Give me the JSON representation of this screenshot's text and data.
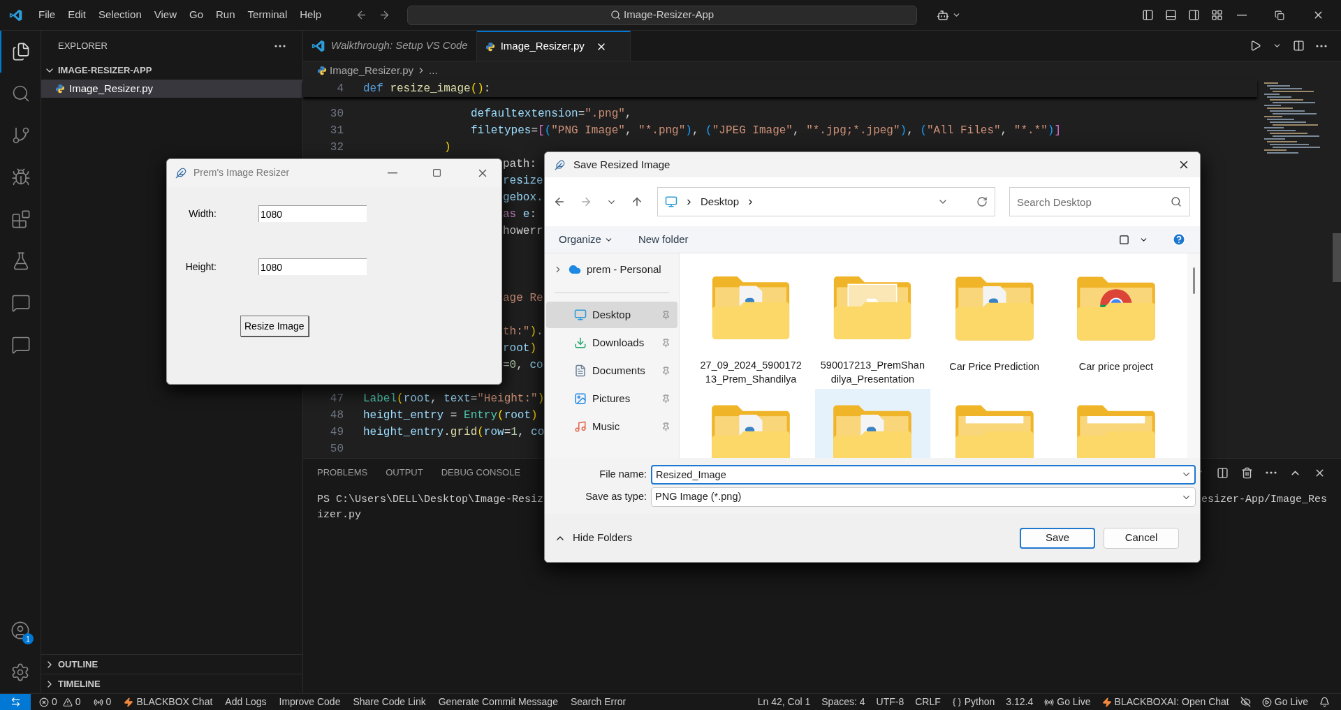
{
  "title_bar": {
    "menu": [
      "File",
      "Edit",
      "Selection",
      "View",
      "Go",
      "Run",
      "Terminal",
      "Help"
    ],
    "search": "Image-Resizer-App"
  },
  "activity_bar": [
    {
      "kind": "explorer",
      "selected": true
    },
    {
      "kind": "search",
      "selected": false
    },
    {
      "kind": "source-control",
      "selected": false
    },
    {
      "kind": "run-debug",
      "selected": false
    },
    {
      "kind": "extensions",
      "selected": false
    },
    {
      "kind": "testing",
      "selected": false
    },
    {
      "kind": "chat",
      "selected": false
    },
    {
      "kind": "chat",
      "selected": false
    }
  ],
  "account_badge": "1",
  "sidebar": {
    "title": "EXPLORER",
    "folder": {
      "label": "IMAGE-RESIZER-APP",
      "expanded": true,
      "files": [
        {
          "label": "Image_Resizer.py",
          "selected": true
        }
      ]
    },
    "sections": [
      {
        "label": "OUTLINE",
        "expanded": false
      },
      {
        "label": "TIMELINE",
        "expanded": false
      }
    ]
  },
  "tabs": [
    {
      "label": "Walkthrough: Setup VS Code",
      "kind": "welcome",
      "selected": false
    },
    {
      "label": "Image_Resizer.py",
      "kind": "python",
      "selected": true
    }
  ],
  "breadcrumb": [
    "Image_Resizer.py",
    "..."
  ],
  "sticky_line": {
    "number": "4",
    "tokens": [
      {
        "kind": "kw",
        "text": "def "
      },
      {
        "kind": "fn",
        "text": "resize_image"
      },
      {
        "kind": "b1",
        "text": "()"
      },
      {
        "kind": "p",
        "text": ":"
      }
    ]
  },
  "code_lines": [
    {
      "kind": "deep",
      "number": "30",
      "tokens": [
        {
          "kind": "var",
          "text": "defaultextension"
        },
        {
          "kind": "p",
          "text": "="
        },
        {
          "kind": "str",
          "text": "\".png\""
        },
        {
          "kind": "p",
          "text": ","
        }
      ]
    },
    {
      "kind": "deep",
      "number": "31",
      "tokens": [
        {
          "kind": "var",
          "text": "filetypes"
        },
        {
          "kind": "p",
          "text": "="
        },
        {
          "kind": "b2",
          "text": "["
        },
        {
          "kind": "b3",
          "text": "("
        },
        {
          "kind": "str",
          "text": "\"PNG Image\""
        },
        {
          "kind": "p",
          "text": ", "
        },
        {
          "kind": "str",
          "text": "\"*.png\""
        },
        {
          "kind": "b3",
          "text": ")"
        },
        {
          "kind": "p",
          "text": ", "
        },
        {
          "kind": "b3",
          "text": "("
        },
        {
          "kind": "str",
          "text": "\"JPEG Image\""
        },
        {
          "kind": "p",
          "text": ", "
        },
        {
          "kind": "str",
          "text": "\"*.jpg;*.jpeg\""
        },
        {
          "kind": "b3",
          "text": ")"
        },
        {
          "kind": "p",
          "text": ", "
        },
        {
          "kind": "b3",
          "text": "("
        },
        {
          "kind": "str",
          "text": "\"All Files\""
        },
        {
          "kind": "p",
          "text": ", "
        },
        {
          "kind": "str",
          "text": "\"*.*\""
        },
        {
          "kind": "b3",
          "text": ")"
        },
        {
          "kind": "b2",
          "text": "]"
        }
      ]
    },
    {
      "kind": "mid",
      "number": "32",
      "tokens": [
        {
          "kind": "b1",
          "text": ")"
        }
      ]
    },
    {
      "kind": "clipped",
      "tokens": [
        {
          "kind": "p",
          "text": "path:"
        }
      ]
    },
    {
      "kind": "clipped",
      "tokens": [
        {
          "kind": "var",
          "text": "resize"
        }
      ]
    },
    {
      "kind": "clipped",
      "tokens": [
        {
          "kind": "var",
          "text": "gebox."
        }
      ]
    },
    {
      "kind": "clipped",
      "tokens": [
        {
          "kind": "ctrl",
          "text": "as"
        },
        {
          "kind": "var",
          "text": " e"
        },
        {
          "kind": "p",
          "text": ":"
        }
      ]
    },
    {
      "kind": "clipped",
      "tokens": [
        {
          "kind": "p",
          "text": "howerr"
        }
      ]
    },
    {
      "kind": "blank"
    },
    {
      "kind": "blank"
    },
    {
      "kind": "blank"
    },
    {
      "kind": "clipped",
      "tokens": [
        {
          "kind": "str",
          "text": "age Re"
        }
      ]
    },
    {
      "kind": "blank"
    },
    {
      "kind": "clipped",
      "tokens": [
        {
          "kind": "str",
          "text": "th:\""
        },
        {
          "kind": "b1",
          "text": ")"
        },
        {
          "kind": "p",
          "text": "."
        }
      ]
    },
    {
      "kind": "clipped",
      "tokens": [
        {
          "kind": "var",
          "text": "root"
        },
        {
          "kind": "b1",
          "text": ")"
        }
      ]
    },
    {
      "kind": "clipped",
      "tokens": [
        {
          "kind": "p",
          "text": "="
        },
        {
          "kind": "num",
          "text": "0"
        },
        {
          "kind": "p",
          "text": ", "
        },
        {
          "kind": "var",
          "text": "co"
        }
      ]
    },
    {
      "kind": "blank"
    },
    {
      "kind": "flush",
      "number": "47",
      "tokens": [
        {
          "kind": "cls",
          "text": "Label"
        },
        {
          "kind": "b1",
          "text": "("
        },
        {
          "kind": "var",
          "text": "root"
        },
        {
          "kind": "p",
          "text": ", "
        },
        {
          "kind": "var",
          "text": "text"
        },
        {
          "kind": "p",
          "text": "="
        },
        {
          "kind": "str",
          "text": "\"Height:\""
        },
        {
          "kind": "b1",
          "text": ")"
        }
      ]
    },
    {
      "kind": "flush",
      "number": "48",
      "tokens": [
        {
          "kind": "var",
          "text": "height_entry"
        },
        {
          "kind": "p",
          "text": " = "
        },
        {
          "kind": "cls",
          "text": "Entry"
        },
        {
          "kind": "b1",
          "text": "("
        },
        {
          "kind": "var",
          "text": "root"
        },
        {
          "kind": "b1",
          "text": ")"
        }
      ]
    },
    {
      "kind": "flush",
      "number": "49",
      "tokens": [
        {
          "kind": "var",
          "text": "height_entry"
        },
        {
          "kind": "p",
          "text": "."
        },
        {
          "kind": "fn",
          "text": "grid"
        },
        {
          "kind": "b1",
          "text": "("
        },
        {
          "kind": "var",
          "text": "row"
        },
        {
          "kind": "p",
          "text": "="
        },
        {
          "kind": "num",
          "text": "1"
        },
        {
          "kind": "p",
          "text": ", "
        },
        {
          "kind": "var",
          "text": "co"
        }
      ]
    },
    {
      "kind": "flush",
      "number": "50"
    }
  ],
  "panel": {
    "tabs": [
      {
        "label": "PROBLEMS",
        "selected": false
      },
      {
        "label": "OUTPUT",
        "selected": false
      },
      {
        "label": "DEBUG CONSOLE",
        "selected": false
      }
    ],
    "terminal_lines": [
      {
        "left": "PS C:\\Users\\DELL\\Desktop\\Image-Resiz",
        "right": "esizer-App/Image_Res"
      },
      {
        "left": "izer.py"
      }
    ]
  },
  "status_bar": {
    "left": [
      {
        "kind": "remote"
      },
      {
        "kind": "problems",
        "errors": "0",
        "warnings": "0"
      },
      {
        "kind": "ports",
        "text": "0"
      },
      {
        "kind": "flash",
        "text": "BLACKBOX Chat"
      },
      {
        "kind": "plain",
        "text": "Add Logs"
      },
      {
        "kind": "plain",
        "text": "Improve Code"
      },
      {
        "kind": "plain",
        "text": "Share Code Link"
      },
      {
        "kind": "plain",
        "text": "Generate Commit Message"
      },
      {
        "kind": "plain",
        "text": "Search Error"
      }
    ],
    "right": [
      {
        "kind": "plain",
        "text": "Ln 42, Col 1"
      },
      {
        "kind": "plain",
        "text": "Spaces: 4"
      },
      {
        "kind": "plain",
        "text": "UTF-8"
      },
      {
        "kind": "plain",
        "text": "CRLF"
      },
      {
        "kind": "braces",
        "text": "Python"
      },
      {
        "kind": "plain",
        "text": "3.12.4"
      },
      {
        "kind": "broadcast",
        "text": "Go Live"
      },
      {
        "kind": "flash",
        "text": "BLACKBOXAI: Open Chat"
      },
      {
        "kind": "hidden-eye"
      },
      {
        "kind": "play-circle",
        "text": "Go Live"
      },
      {
        "kind": "bell"
      }
    ]
  },
  "tk_window": {
    "title": "Prem's Image Resizer",
    "fields": [
      {
        "label": "Width:",
        "value": "1080"
      },
      {
        "label": "Height:",
        "value": "1080"
      }
    ],
    "button": "Resize Image"
  },
  "save_dialog": {
    "title": "Save Resized Image",
    "path": [
      "Desktop"
    ],
    "search_placeholder": "Search Desktop",
    "organize": "Organize",
    "new_folder": "New folder",
    "nav": [
      {
        "label": "prem - Personal",
        "kind": "cloud",
        "selected": false,
        "pinned": false
      },
      {
        "label": "Desktop",
        "kind": "desktop",
        "selected": true,
        "pinned": true
      },
      {
        "label": "Downloads",
        "kind": "downloads",
        "selected": false,
        "pinned": true
      },
      {
        "label": "Documents",
        "kind": "documents",
        "selected": false,
        "pinned": true
      },
      {
        "label": "Pictures",
        "kind": "pictures",
        "selected": false,
        "pinned": true
      },
      {
        "label": "Music",
        "kind": "music",
        "selected": false,
        "pinned": true
      }
    ],
    "items": [
      {
        "label": "27_09_2024_590017213_Prem_Shandilya",
        "kind": "python",
        "selected": false
      },
      {
        "label": "590017213_PremShandilya_Presentation",
        "kind": "document",
        "selected": false
      },
      {
        "label": "Car Price Prediction",
        "kind": "python",
        "selected": false
      },
      {
        "label": "Car price project",
        "kind": "ring",
        "selected": false
      },
      {
        "kind": "python",
        "selected": false
      },
      {
        "kind": "python",
        "selected": true
      },
      {
        "kind": "plain",
        "selected": false
      },
      {
        "kind": "plain",
        "selected": false
      }
    ],
    "file_name_label": "File name:",
    "file_name": "Resized_Image",
    "type_label": "Save as type:",
    "save_as_type": "PNG Image (*.png)",
    "hide_folders": "Hide Folders",
    "buttons": [
      "Save",
      "Cancel"
    ]
  }
}
